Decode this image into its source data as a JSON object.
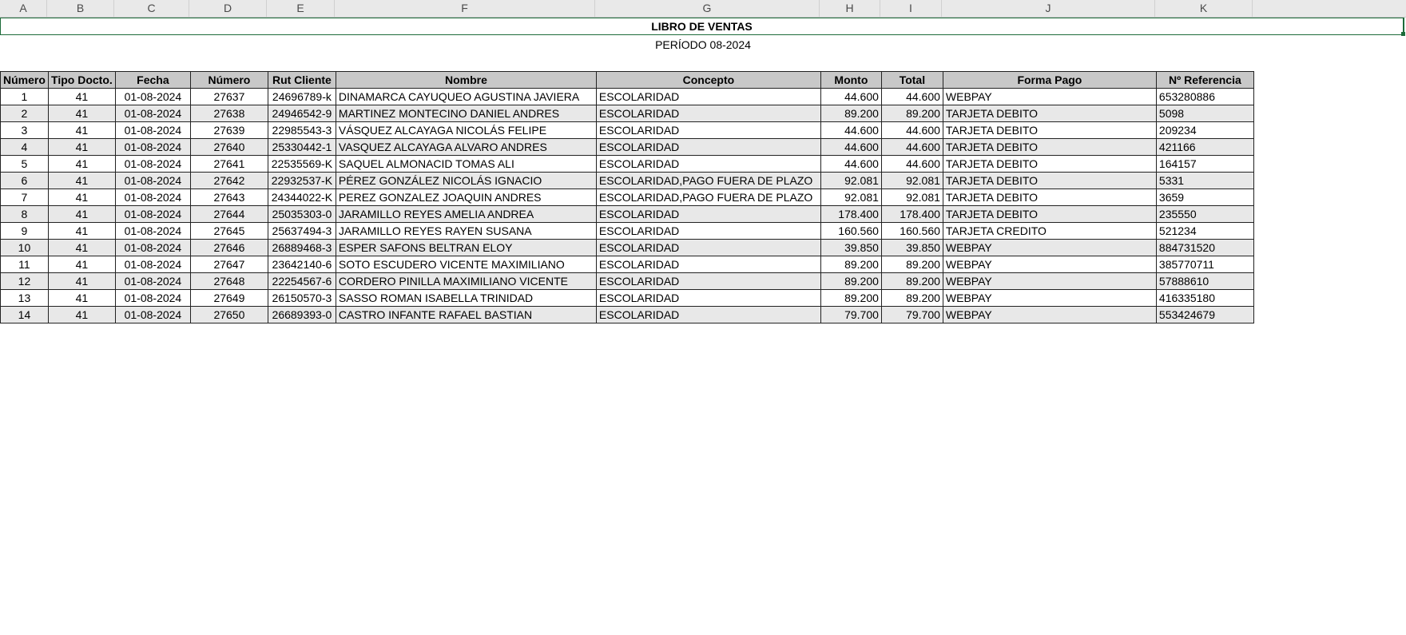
{
  "columns": [
    "A",
    "B",
    "C",
    "D",
    "E",
    "F",
    "G",
    "H",
    "I",
    "J",
    "K"
  ],
  "title": "LIBRO DE VENTAS",
  "subtitle": "PERÍODO 08-2024",
  "table": {
    "headers": [
      "Número",
      "Tipo Docto.",
      "Fecha",
      "Número",
      "Rut Cliente",
      "Nombre",
      "Concepto",
      "Monto",
      "Total",
      "Forma Pago",
      "Nº Referencia"
    ],
    "rows": [
      [
        "1",
        "41",
        "01-08-2024",
        "27637",
        "24696789-k",
        "DINAMARCA CAYUQUEO AGUSTINA JAVIERA",
        "ESCOLARIDAD",
        "44.600",
        "44.600",
        "WEBPAY",
        "653280886"
      ],
      [
        "2",
        "41",
        "01-08-2024",
        "27638",
        "24946542-9",
        "MARTINEZ MONTECINO DANIEL ANDRES",
        "ESCOLARIDAD",
        "89.200",
        "89.200",
        "TARJETA DEBITO",
        "5098"
      ],
      [
        "3",
        "41",
        "01-08-2024",
        "27639",
        "22985543-3",
        "VÁSQUEZ ALCAYAGA NICOLÁS FELIPE",
        "ESCOLARIDAD",
        "44.600",
        "44.600",
        "TARJETA DEBITO",
        "209234"
      ],
      [
        "4",
        "41",
        "01-08-2024",
        "27640",
        "25330442-1",
        "VASQUEZ ALCAYAGA ALVARO ANDRES",
        "ESCOLARIDAD",
        "44.600",
        "44.600",
        "TARJETA DEBITO",
        "421166"
      ],
      [
        "5",
        "41",
        "01-08-2024",
        "27641",
        "22535569-K",
        "SAQUEL ALMONACID TOMAS ALI",
        "ESCOLARIDAD",
        "44.600",
        "44.600",
        "TARJETA DEBITO",
        "164157"
      ],
      [
        "6",
        "41",
        "01-08-2024",
        "27642",
        "22932537-K",
        "PÉREZ GONZÁLEZ NICOLÁS IGNACIO",
        "ESCOLARIDAD,PAGO FUERA DE PLAZO",
        "92.081",
        "92.081",
        "TARJETA DEBITO",
        "5331"
      ],
      [
        "7",
        "41",
        "01-08-2024",
        "27643",
        "24344022-K",
        "PEREZ GONZALEZ JOAQUIN ANDRES",
        "ESCOLARIDAD,PAGO FUERA DE PLAZO",
        "92.081",
        "92.081",
        "TARJETA DEBITO",
        "3659"
      ],
      [
        "8",
        "41",
        "01-08-2024",
        "27644",
        "25035303-0",
        "JARAMILLO REYES AMELIA ANDREA",
        "ESCOLARIDAD",
        "178.400",
        "178.400",
        "TARJETA DEBITO",
        "235550"
      ],
      [
        "9",
        "41",
        "01-08-2024",
        "27645",
        "25637494-3",
        "JARAMILLO REYES RAYEN SUSANA",
        "ESCOLARIDAD",
        "160.560",
        "160.560",
        "TARJETA CREDITO",
        "521234"
      ],
      [
        "10",
        "41",
        "01-08-2024",
        "27646",
        "26889468-3",
        "ESPER SAFONS BELTRAN ELOY",
        "ESCOLARIDAD",
        "39.850",
        "39.850",
        "WEBPAY",
        "884731520"
      ],
      [
        "11",
        "41",
        "01-08-2024",
        "27647",
        "23642140-6",
        "SOTO ESCUDERO VICENTE MAXIMILIANO",
        "ESCOLARIDAD",
        "89.200",
        "89.200",
        "WEBPAY",
        "385770711"
      ],
      [
        "12",
        "41",
        "01-08-2024",
        "27648",
        "22254567-6",
        "CORDERO PINILLA MAXIMILIANO VICENTE",
        "ESCOLARIDAD",
        "89.200",
        "89.200",
        "WEBPAY",
        "57888610"
      ],
      [
        "13",
        "41",
        "01-08-2024",
        "27649",
        "26150570-3",
        "SASSO ROMAN ISABELLA TRINIDAD",
        "ESCOLARIDAD",
        "89.200",
        "89.200",
        "WEBPAY",
        "416335180"
      ],
      [
        "14",
        "41",
        "01-08-2024",
        "27650",
        "26689393-0",
        "CASTRO INFANTE RAFAEL BASTIAN",
        "ESCOLARIDAD",
        "79.700",
        "79.700",
        "WEBPAY",
        "553424679"
      ]
    ]
  },
  "colors": {
    "selection_border": "#1d6b3a",
    "header_fill": "#c8c8c8",
    "band_fill": "#e8e8e8"
  }
}
